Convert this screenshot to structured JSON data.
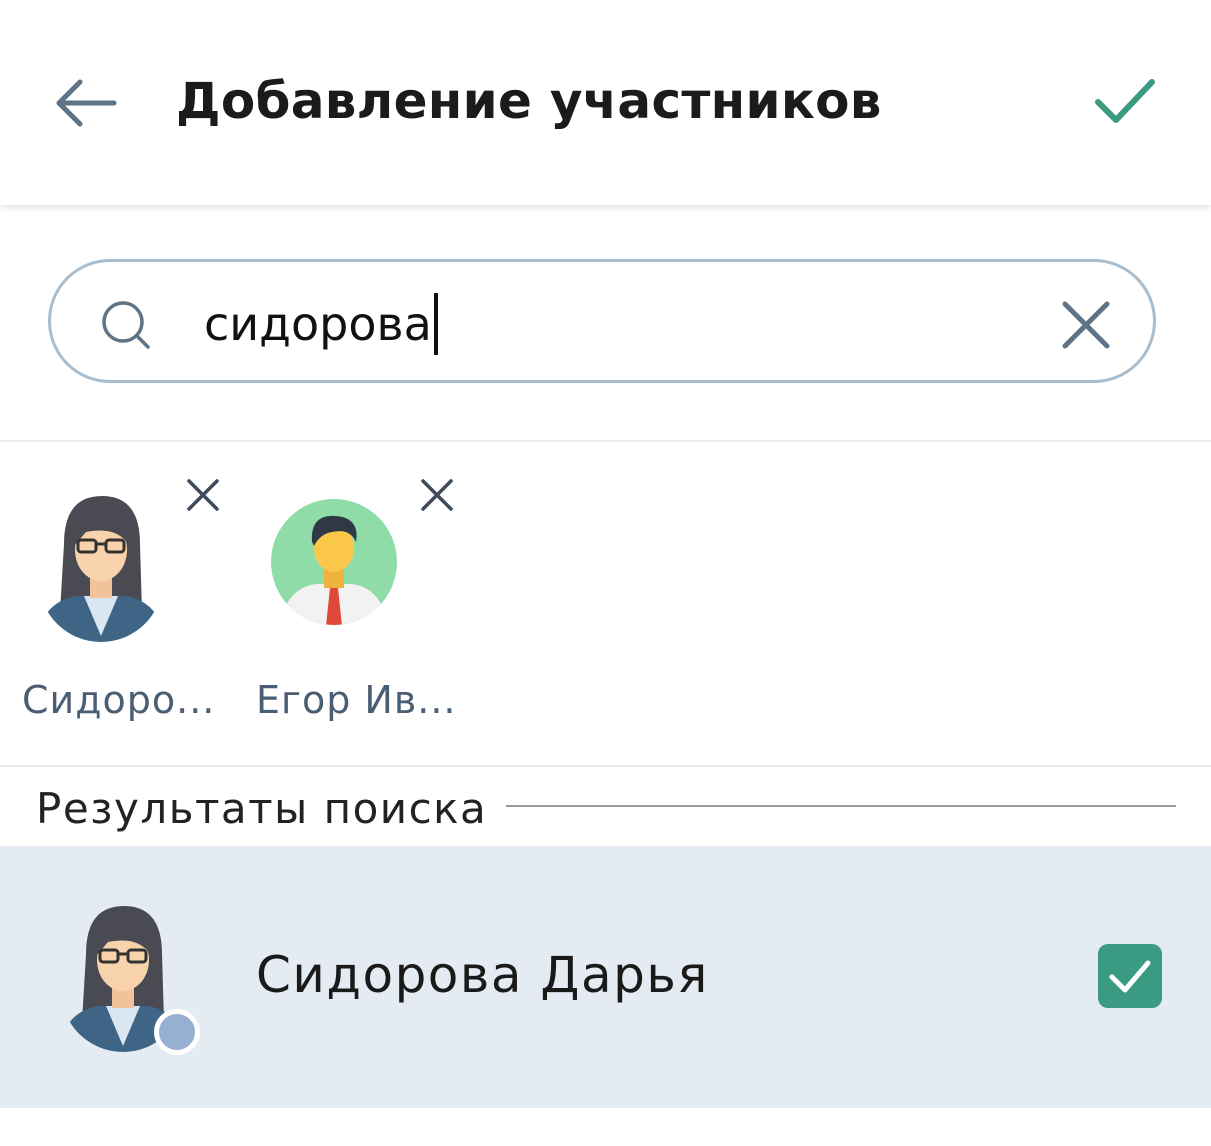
{
  "header": {
    "title": "Добавление участников",
    "back_icon": "arrow-left-icon",
    "confirm_icon": "checkmark-icon"
  },
  "search": {
    "value": "сидорова",
    "icon": "search-icon",
    "clear_icon": "close-icon"
  },
  "selected": [
    {
      "label": "Сидоро...",
      "avatar": "woman-glasses-avatar",
      "remove_icon": "close-icon"
    },
    {
      "label": "Егор Ив...",
      "avatar": "man-tie-avatar",
      "remove_icon": "close-icon"
    }
  ],
  "results_section": {
    "title": "Результаты поиска"
  },
  "results": [
    {
      "name": "Сидорова Дарья",
      "avatar": "woman-glasses-avatar",
      "checked": true,
      "status": "online-dot"
    }
  ],
  "colors": {
    "accent": "#3a9a82",
    "header_icon": "#5e7386",
    "search_border": "#aabdcc",
    "row_highlight": "#e5ebf3",
    "status_dot": "#97afd2",
    "chip_label": "#4a5e73"
  }
}
